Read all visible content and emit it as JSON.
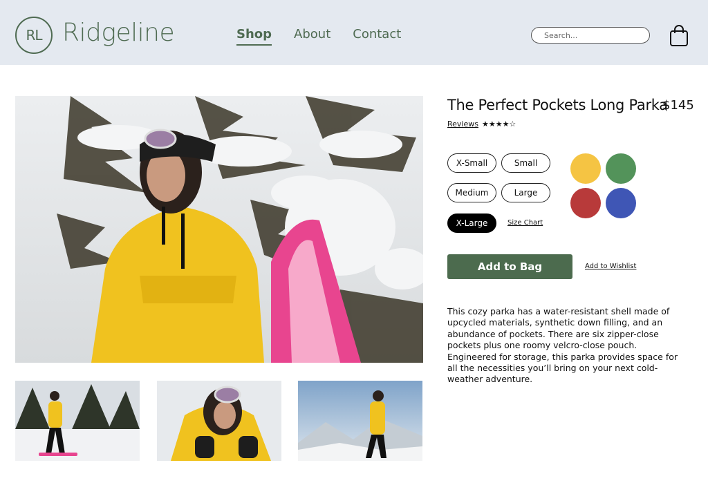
{
  "brand": {
    "logo_initials": "RL",
    "name": "Ridgeline",
    "color": "#4f6b52"
  },
  "nav": {
    "items": [
      {
        "label": "Shop",
        "active": true
      },
      {
        "label": "About",
        "active": false
      },
      {
        "label": "Contact",
        "active": false
      }
    ]
  },
  "search": {
    "placeholder": "Search...",
    "value": ""
  },
  "icons": {
    "bag": "shopping-bag-icon",
    "stars": "star-rating-icon"
  },
  "product": {
    "title": "The Perfect Pockets Long Parka",
    "price": "$145",
    "reviews_label": "Reviews",
    "rating": 4,
    "rating_max": 5,
    "rating_glyphs": "★★★★☆",
    "sizes": [
      {
        "label": "X-Small",
        "selected": false
      },
      {
        "label": "Small",
        "selected": false
      },
      {
        "label": "Medium",
        "selected": false
      },
      {
        "label": "Large",
        "selected": false
      },
      {
        "label": "X-Large",
        "selected": true
      }
    ],
    "size_chart_label": "Size Chart",
    "colors": [
      "#f5c443",
      "#53935a",
      "#b83a3a",
      "#3f56b5"
    ],
    "add_to_bag_label": "Add to Bag",
    "wishlist_label": "Add to Wishlist",
    "description": "This cozy parka has a water-resistant shell made of upcycled materials, synthetic down filling, and an abundance of pockets. There are six zipper-close pockets plus one roomy velcro-close pouch. Engineered for storage, this parka provides space for all the necessities you’ll bring on your next cold-weather adventure."
  },
  "accent_colors": {
    "primary_button": "#4c6b4e",
    "header_bg": "#e4e9f0",
    "jacket_yellow": "#f0c21f"
  }
}
